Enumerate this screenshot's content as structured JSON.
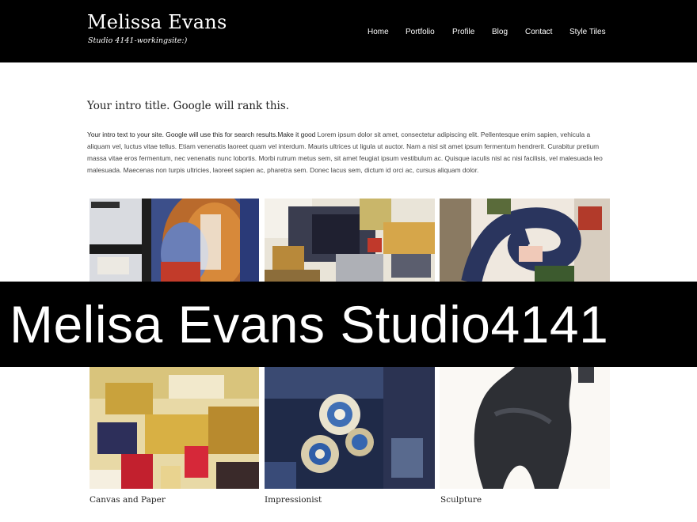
{
  "header": {
    "title": "Melissa Evans",
    "tagline": "Studio 4141-workingsite:)"
  },
  "nav": {
    "items": [
      "Home",
      "Portfolio",
      "Profile",
      "Blog",
      "Contact",
      "Style Tiles"
    ]
  },
  "intro": {
    "title": "Your intro title. Google will rank this.",
    "lead": "Your intro text to your site. Google will use this for  search results.Make it good",
    "body": " Lorem ipsum dolor sit amet, consectetur adipiscing elit. Pellentesque enim sapien, vehicula a aliquam vel, luctus vitae tellus. Etiam venenatis laoreet quam vel interdum. Mauris ultrices ut ligula ut auctor. Nam a nisl sit amet ipsum fermentum hendrerit. Curabitur pretium massa vitae eros fermentum, nec venenatis nunc lobortis. Morbi rutrum metus sem, sit amet feugiat ipsum vestibulum ac. Quisque iaculis nisl ac nisi facilisis, vel malesuada leo malesuada. Maecenas non turpis ultricies, laoreet sapien ac, pharetra sem. Donec lacus sem, dictum id orci ac, cursus aliquam dolor."
  },
  "gallery": {
    "captions": [
      "Canvas and Paper",
      "Impressionist",
      "Sculpture"
    ]
  },
  "overlay": {
    "text": "Melisa Evans Studio4141"
  },
  "colors": {
    "header_bg": "#000000",
    "banner_bg": "#000000",
    "text_dark": "#222222"
  }
}
